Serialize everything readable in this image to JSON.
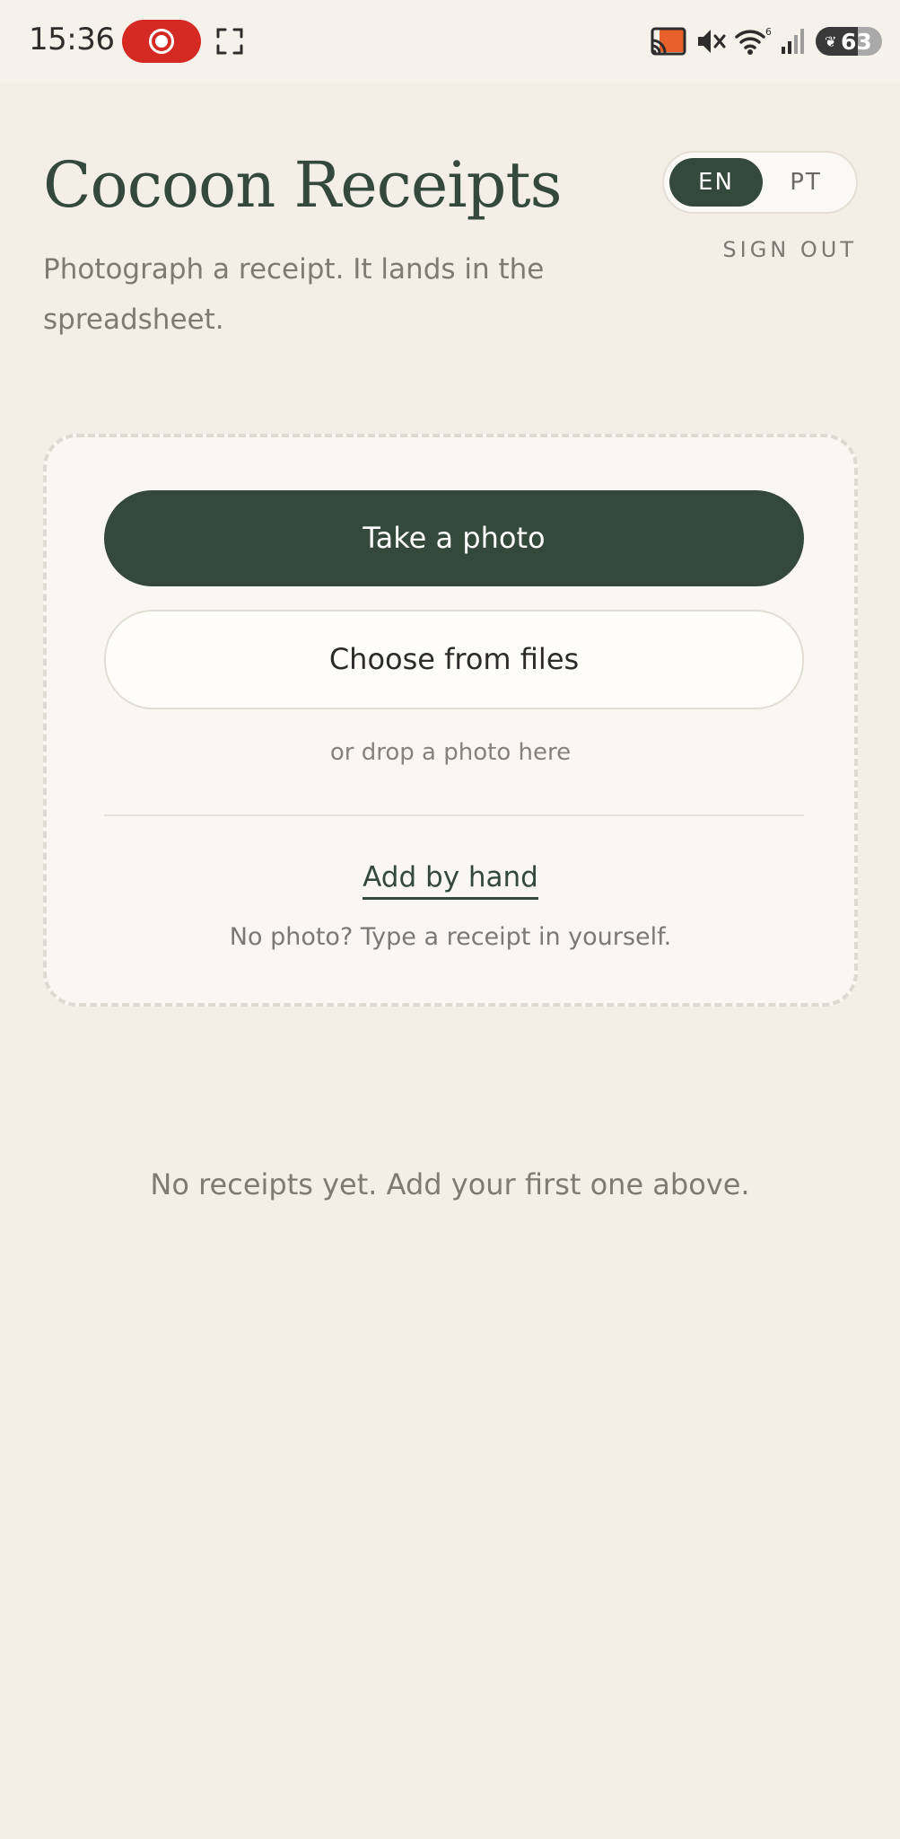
{
  "status_bar": {
    "time": "15:36",
    "battery": "63",
    "battery_fraction": 0.63,
    "icons": [
      "screen-record-icon",
      "expand-icon",
      "cast-icon",
      "mute-icon",
      "wifi-icon",
      "signal-icon",
      "battery-icon"
    ]
  },
  "header": {
    "title": "Cocoon Receipts",
    "subtitle": "Photograph a receipt. It lands in the spreadsheet."
  },
  "language_toggle": {
    "options": [
      "EN",
      "PT"
    ],
    "selected": "EN"
  },
  "sign_out_label": "SIGN OUT",
  "upload": {
    "take_photo_label": "Take a photo",
    "choose_files_label": "Choose from files",
    "drop_hint": "or drop a photo here",
    "add_by_hand_label": "Add by hand",
    "add_by_hand_hint": "No photo? Type a receipt in yourself."
  },
  "receipts": {
    "empty_message": "No receipts yet. Add your first one above."
  },
  "colors": {
    "accent": "#34483c",
    "background": "#f3efe7",
    "card": "#faf7f2",
    "record": "#d52a24"
  }
}
